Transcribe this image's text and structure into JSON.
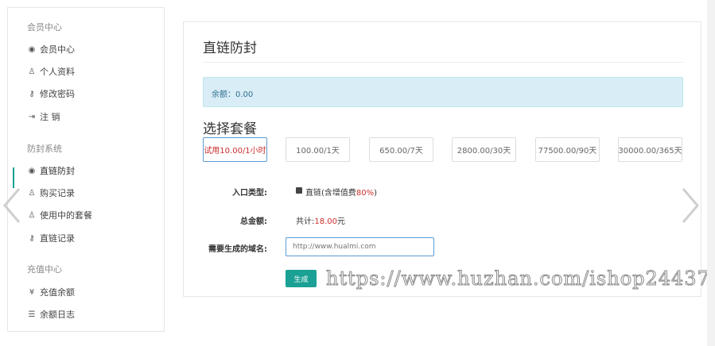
{
  "sidebar": {
    "groups": [
      {
        "title": "会员中心",
        "items": [
          {
            "label": "会员中心",
            "icon": "user-circle-icon",
            "glyph": "◉"
          },
          {
            "label": "个人资料",
            "icon": "user-icon",
            "glyph": "♙"
          },
          {
            "label": "修改密码",
            "icon": "key-icon",
            "glyph": "⚷"
          },
          {
            "label": "注 销",
            "icon": "sign-out-icon",
            "glyph": "⇥"
          }
        ]
      },
      {
        "title": "防封系统",
        "items": [
          {
            "label": "直链防封",
            "icon": "user-circle-icon",
            "glyph": "◉"
          },
          {
            "label": "购买记录",
            "icon": "user-icon",
            "glyph": "♙"
          },
          {
            "label": "使用中的套餐",
            "icon": "user-icon",
            "glyph": "♙"
          },
          {
            "label": "直链记录",
            "icon": "key-icon",
            "glyph": "⚷"
          }
        ]
      },
      {
        "title": "充值中心",
        "items": [
          {
            "label": "充值余额",
            "icon": "yen-icon",
            "glyph": "¥"
          },
          {
            "label": "余额日志",
            "icon": "list-icon",
            "glyph": "☰"
          }
        ]
      }
    ]
  },
  "main": {
    "title": "直链防封",
    "balance": "余额：0.00",
    "choose_title": "选择套餐",
    "plans": [
      "试用10.00/1小时",
      "100.00/1天",
      "650.00/7天",
      "2800.00/30天",
      "77500.00/90天",
      "30000.00/365天"
    ],
    "entry_label": "入口类型:",
    "entry_option_prefix": "直链(含增值费",
    "entry_option_pct": "80%",
    "entry_option_suffix": ")",
    "total_label": "总金额:",
    "total_prefix": "共计:",
    "total_amount": "18.00",
    "total_suffix": "元",
    "domain_label": "需要生成的域名:",
    "domain_placeholder": "http://www.hualmi.com",
    "generate_label": "生成"
  },
  "watermark": "https://www.huzhan.com/ishop24437",
  "colors": {
    "accent": "#1aa094",
    "alert_bg": "#d9edf7",
    "highlight": "#c9302c",
    "selected_border": "#5b9bd5"
  }
}
